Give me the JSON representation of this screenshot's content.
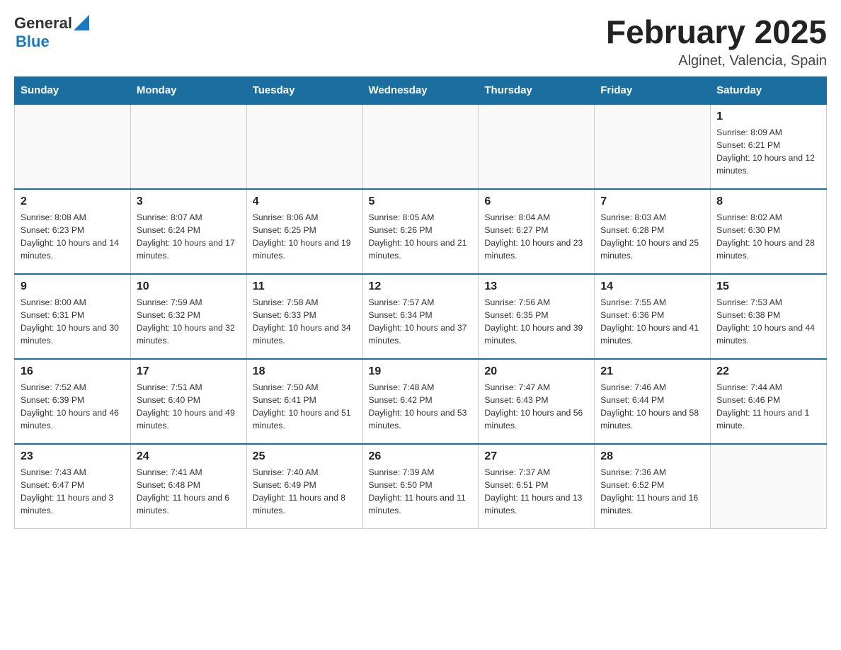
{
  "header": {
    "logo_general": "General",
    "logo_blue": "Blue",
    "month_title": "February 2025",
    "location": "Alginet, Valencia, Spain"
  },
  "calendar": {
    "days_of_week": [
      "Sunday",
      "Monday",
      "Tuesday",
      "Wednesday",
      "Thursday",
      "Friday",
      "Saturday"
    ],
    "weeks": [
      [
        {
          "day": "",
          "info": "",
          "empty": true
        },
        {
          "day": "",
          "info": "",
          "empty": true
        },
        {
          "day": "",
          "info": "",
          "empty": true
        },
        {
          "day": "",
          "info": "",
          "empty": true
        },
        {
          "day": "",
          "info": "",
          "empty": true
        },
        {
          "day": "",
          "info": "",
          "empty": true
        },
        {
          "day": "1",
          "info": "Sunrise: 8:09 AM\nSunset: 6:21 PM\nDaylight: 10 hours and 12 minutes.",
          "empty": false
        }
      ],
      [
        {
          "day": "2",
          "info": "Sunrise: 8:08 AM\nSunset: 6:23 PM\nDaylight: 10 hours and 14 minutes.",
          "empty": false
        },
        {
          "day": "3",
          "info": "Sunrise: 8:07 AM\nSunset: 6:24 PM\nDaylight: 10 hours and 17 minutes.",
          "empty": false
        },
        {
          "day": "4",
          "info": "Sunrise: 8:06 AM\nSunset: 6:25 PM\nDaylight: 10 hours and 19 minutes.",
          "empty": false
        },
        {
          "day": "5",
          "info": "Sunrise: 8:05 AM\nSunset: 6:26 PM\nDaylight: 10 hours and 21 minutes.",
          "empty": false
        },
        {
          "day": "6",
          "info": "Sunrise: 8:04 AM\nSunset: 6:27 PM\nDaylight: 10 hours and 23 minutes.",
          "empty": false
        },
        {
          "day": "7",
          "info": "Sunrise: 8:03 AM\nSunset: 6:28 PM\nDaylight: 10 hours and 25 minutes.",
          "empty": false
        },
        {
          "day": "8",
          "info": "Sunrise: 8:02 AM\nSunset: 6:30 PM\nDaylight: 10 hours and 28 minutes.",
          "empty": false
        }
      ],
      [
        {
          "day": "9",
          "info": "Sunrise: 8:00 AM\nSunset: 6:31 PM\nDaylight: 10 hours and 30 minutes.",
          "empty": false
        },
        {
          "day": "10",
          "info": "Sunrise: 7:59 AM\nSunset: 6:32 PM\nDaylight: 10 hours and 32 minutes.",
          "empty": false
        },
        {
          "day": "11",
          "info": "Sunrise: 7:58 AM\nSunset: 6:33 PM\nDaylight: 10 hours and 34 minutes.",
          "empty": false
        },
        {
          "day": "12",
          "info": "Sunrise: 7:57 AM\nSunset: 6:34 PM\nDaylight: 10 hours and 37 minutes.",
          "empty": false
        },
        {
          "day": "13",
          "info": "Sunrise: 7:56 AM\nSunset: 6:35 PM\nDaylight: 10 hours and 39 minutes.",
          "empty": false
        },
        {
          "day": "14",
          "info": "Sunrise: 7:55 AM\nSunset: 6:36 PM\nDaylight: 10 hours and 41 minutes.",
          "empty": false
        },
        {
          "day": "15",
          "info": "Sunrise: 7:53 AM\nSunset: 6:38 PM\nDaylight: 10 hours and 44 minutes.",
          "empty": false
        }
      ],
      [
        {
          "day": "16",
          "info": "Sunrise: 7:52 AM\nSunset: 6:39 PM\nDaylight: 10 hours and 46 minutes.",
          "empty": false
        },
        {
          "day": "17",
          "info": "Sunrise: 7:51 AM\nSunset: 6:40 PM\nDaylight: 10 hours and 49 minutes.",
          "empty": false
        },
        {
          "day": "18",
          "info": "Sunrise: 7:50 AM\nSunset: 6:41 PM\nDaylight: 10 hours and 51 minutes.",
          "empty": false
        },
        {
          "day": "19",
          "info": "Sunrise: 7:48 AM\nSunset: 6:42 PM\nDaylight: 10 hours and 53 minutes.",
          "empty": false
        },
        {
          "day": "20",
          "info": "Sunrise: 7:47 AM\nSunset: 6:43 PM\nDaylight: 10 hours and 56 minutes.",
          "empty": false
        },
        {
          "day": "21",
          "info": "Sunrise: 7:46 AM\nSunset: 6:44 PM\nDaylight: 10 hours and 58 minutes.",
          "empty": false
        },
        {
          "day": "22",
          "info": "Sunrise: 7:44 AM\nSunset: 6:46 PM\nDaylight: 11 hours and 1 minute.",
          "empty": false
        }
      ],
      [
        {
          "day": "23",
          "info": "Sunrise: 7:43 AM\nSunset: 6:47 PM\nDaylight: 11 hours and 3 minutes.",
          "empty": false
        },
        {
          "day": "24",
          "info": "Sunrise: 7:41 AM\nSunset: 6:48 PM\nDaylight: 11 hours and 6 minutes.",
          "empty": false
        },
        {
          "day": "25",
          "info": "Sunrise: 7:40 AM\nSunset: 6:49 PM\nDaylight: 11 hours and 8 minutes.",
          "empty": false
        },
        {
          "day": "26",
          "info": "Sunrise: 7:39 AM\nSunset: 6:50 PM\nDaylight: 11 hours and 11 minutes.",
          "empty": false
        },
        {
          "day": "27",
          "info": "Sunrise: 7:37 AM\nSunset: 6:51 PM\nDaylight: 11 hours and 13 minutes.",
          "empty": false
        },
        {
          "day": "28",
          "info": "Sunrise: 7:36 AM\nSunset: 6:52 PM\nDaylight: 11 hours and 16 minutes.",
          "empty": false
        },
        {
          "day": "",
          "info": "",
          "empty": true
        }
      ]
    ]
  }
}
